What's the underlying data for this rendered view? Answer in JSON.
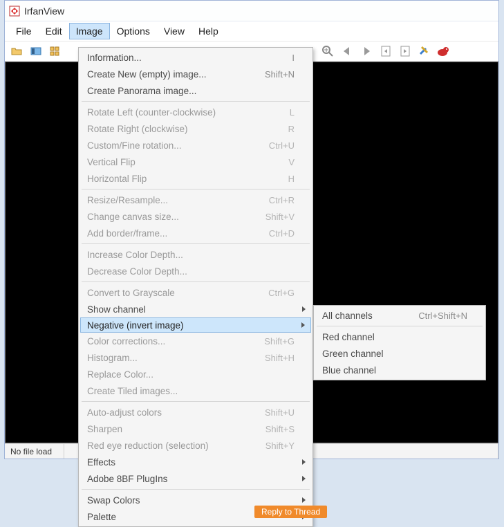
{
  "app": {
    "title": "IrfanView"
  },
  "menubar": [
    "File",
    "Edit",
    "Image",
    "Options",
    "View",
    "Help"
  ],
  "menubar_open_index": 2,
  "image_menu": {
    "groups": [
      [
        {
          "label": "Information...",
          "accel": "I",
          "enabled": true
        },
        {
          "label": "Create New (empty) image...",
          "accel": "Shift+N",
          "enabled": true
        },
        {
          "label": "Create Panorama image...",
          "accel": "",
          "enabled": true
        }
      ],
      [
        {
          "label": "Rotate Left (counter-clockwise)",
          "accel": "L",
          "enabled": false
        },
        {
          "label": "Rotate Right (clockwise)",
          "accel": "R",
          "enabled": false
        },
        {
          "label": "Custom/Fine rotation...",
          "accel": "Ctrl+U",
          "enabled": false
        },
        {
          "label": "Vertical Flip",
          "accel": "V",
          "enabled": false
        },
        {
          "label": "Horizontal Flip",
          "accel": "H",
          "enabled": false
        }
      ],
      [
        {
          "label": "Resize/Resample...",
          "accel": "Ctrl+R",
          "enabled": false
        },
        {
          "label": "Change canvas size...",
          "accel": "Shift+V",
          "enabled": false
        },
        {
          "label": "Add border/frame...",
          "accel": "Ctrl+D",
          "enabled": false
        }
      ],
      [
        {
          "label": "Increase Color Depth...",
          "accel": "",
          "enabled": false
        },
        {
          "label": "Decrease Color Depth...",
          "accel": "",
          "enabled": false
        }
      ],
      [
        {
          "label": "Convert to Grayscale",
          "accel": "Ctrl+G",
          "enabled": false
        },
        {
          "label": "Show channel",
          "accel": "",
          "enabled": true,
          "submenu": true
        },
        {
          "label": "Negative (invert image)",
          "accel": "",
          "enabled": true,
          "submenu": true,
          "highlight": true
        },
        {
          "label": "Color corrections...",
          "accel": "Shift+G",
          "enabled": false
        },
        {
          "label": "Histogram...",
          "accel": "Shift+H",
          "enabled": false
        },
        {
          "label": "Replace Color...",
          "accel": "",
          "enabled": false
        },
        {
          "label": "Create Tiled images...",
          "accel": "",
          "enabled": false
        }
      ],
      [
        {
          "label": "Auto-adjust colors",
          "accel": "Shift+U",
          "enabled": false
        },
        {
          "label": "Sharpen",
          "accel": "Shift+S",
          "enabled": false
        },
        {
          "label": "Red eye reduction (selection)",
          "accel": "Shift+Y",
          "enabled": false
        },
        {
          "label": "Effects",
          "accel": "",
          "enabled": true,
          "submenu": true
        },
        {
          "label": "Adobe 8BF PlugIns",
          "accel": "",
          "enabled": true,
          "submenu": true
        }
      ],
      [
        {
          "label": "Swap Colors",
          "accel": "",
          "enabled": true,
          "submenu": true
        },
        {
          "label": "Palette",
          "accel": "",
          "enabled": true,
          "submenu": true
        }
      ]
    ]
  },
  "negative_submenu": [
    {
      "label": "All channels",
      "accel": "Ctrl+Shift+N"
    },
    {
      "label": "Red channel",
      "accel": ""
    },
    {
      "label": "Green channel",
      "accel": ""
    },
    {
      "label": "Blue channel",
      "accel": ""
    }
  ],
  "status": {
    "file": "No file load"
  },
  "reply_btn": "Reply to Thread"
}
